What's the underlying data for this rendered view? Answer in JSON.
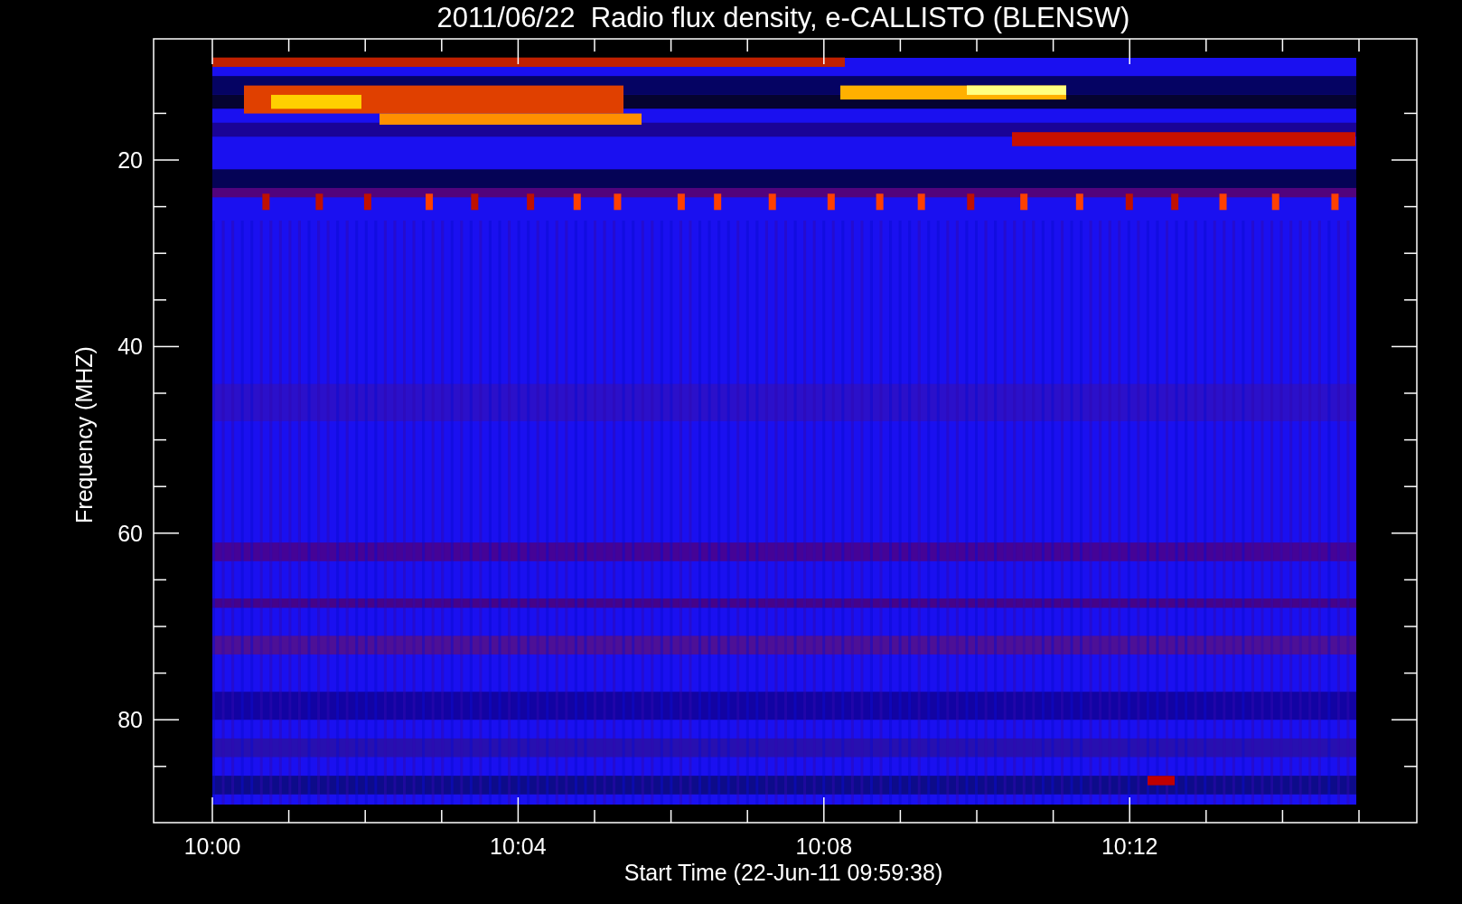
{
  "title": "2011/06/22  Radio flux density, e-CALLISTO (BLENSW)",
  "y_axis": {
    "label": "Frequency (MHZ)",
    "tick_labels": [
      "20",
      "40",
      "60",
      "80"
    ]
  },
  "x_axis": {
    "label": "Start Time (22-Jun-11 09:59:38)",
    "tick_labels": [
      "10:00",
      "10:04",
      "10:08",
      "10:12"
    ]
  }
}
